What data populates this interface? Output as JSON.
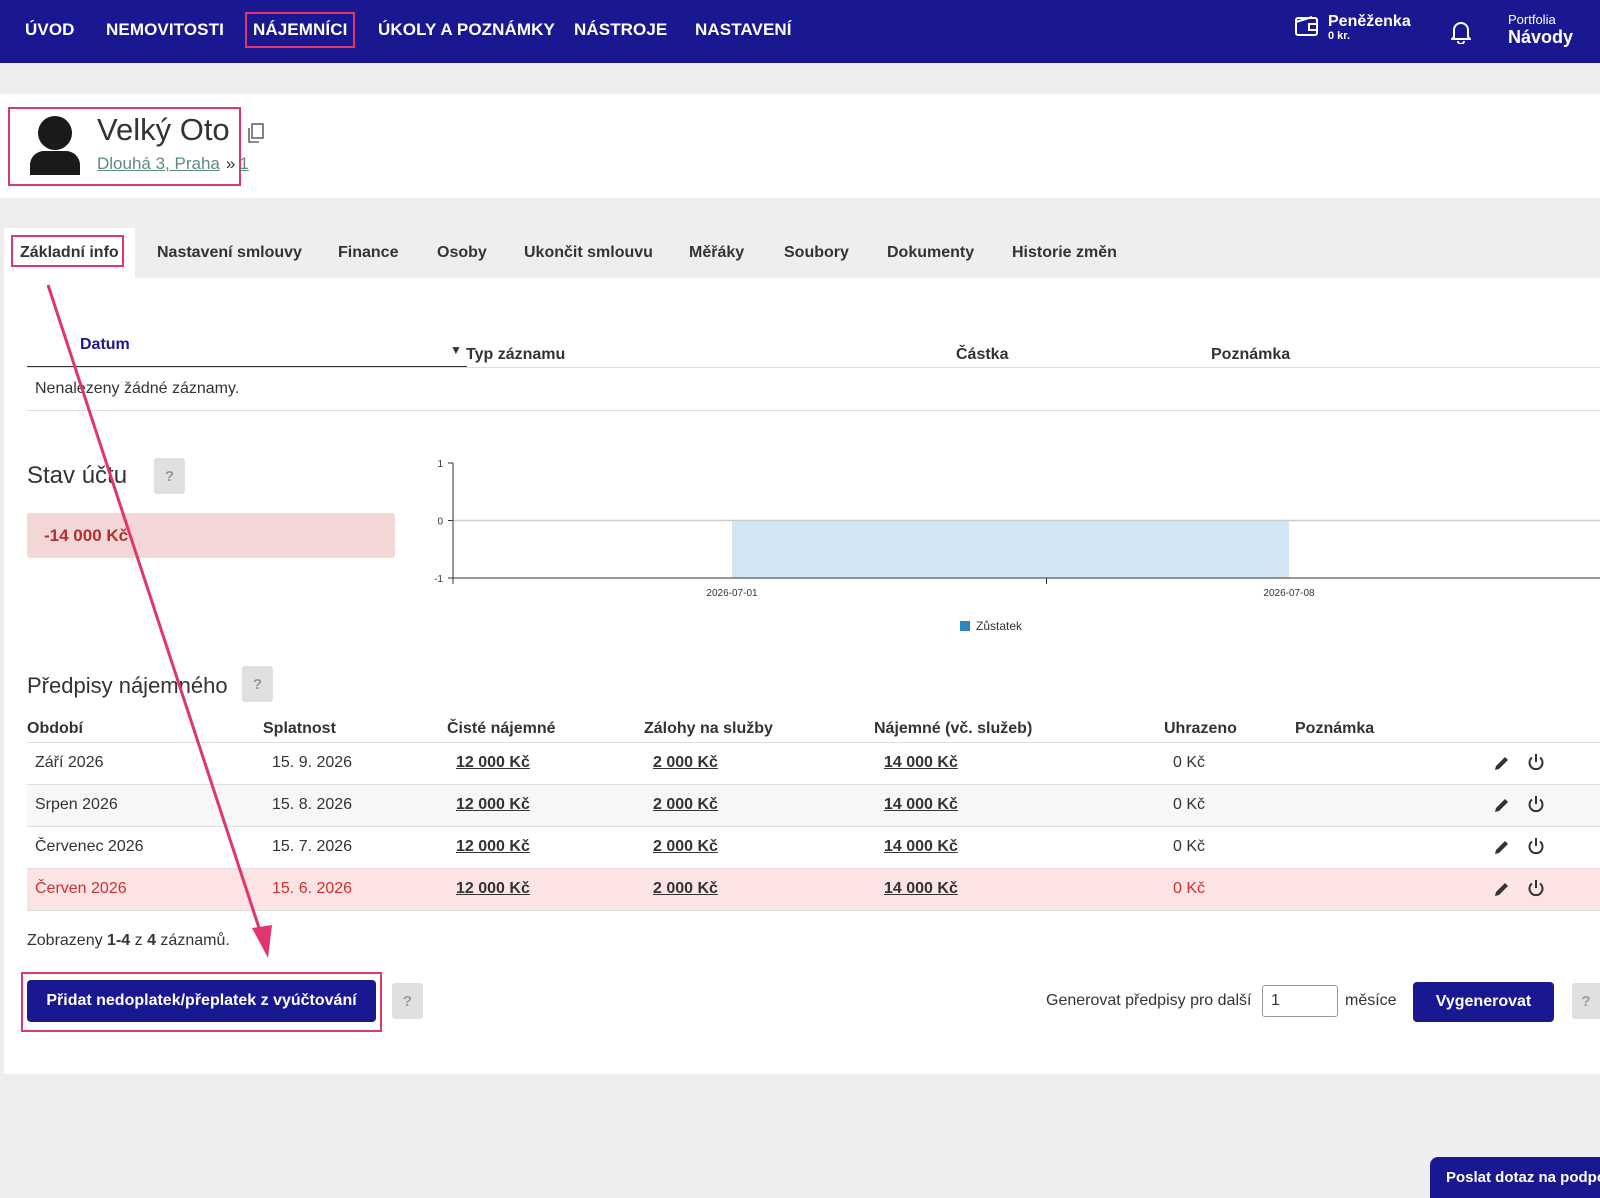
{
  "nav": {
    "items": [
      {
        "label": "ÚVOD"
      },
      {
        "label": "NEMOVITOSTI"
      },
      {
        "label": "NÁJEMNÍCI"
      },
      {
        "label": "ÚKOLY A POZNÁMKY"
      },
      {
        "label": "NÁSTROJE"
      },
      {
        "label": "NASTAVENÍ"
      }
    ],
    "active_index": 2,
    "wallet_title": "Peněženka",
    "wallet_amount": "0 kr.",
    "portfolio_label": "Portfolia",
    "portfolio_value": "Návody"
  },
  "tenant": {
    "name": "Velký Oto",
    "address_link": "Dlouhá 3, Praha",
    "separator": "»",
    "unit_link": "1"
  },
  "tabs": [
    {
      "label": "Základní info"
    },
    {
      "label": "Nastavení smlouvy"
    },
    {
      "label": "Finance"
    },
    {
      "label": "Osoby"
    },
    {
      "label": "Ukončit smlouvu"
    },
    {
      "label": "Měřáky"
    },
    {
      "label": "Soubory"
    },
    {
      "label": "Dokumenty"
    },
    {
      "label": "Historie změn"
    }
  ],
  "records": {
    "columns": [
      "Datum",
      "Typ záznamu",
      "Částka",
      "Poznámka"
    ],
    "sort_indicator": "▼",
    "empty_text": "Nenalezeny žádné záznamy."
  },
  "account": {
    "title": "Stav účtu",
    "help": "?",
    "balance": "-14 000 Kč"
  },
  "chart_data": {
    "type": "area",
    "x": [
      "2026-07-01",
      "2026-07-08"
    ],
    "series": [
      {
        "name": "Zůstatek",
        "values": [
          0,
          0
        ]
      }
    ],
    "ylim": [
      -1,
      1
    ],
    "yticks": [
      "1",
      "0",
      "-1"
    ],
    "xticks": [
      "2026-07-01",
      "2026-07-08"
    ],
    "legend_position": "bottom",
    "series_color": "#2e86c1",
    "fill_color": "#d4e6f4"
  },
  "rent": {
    "title": "Předpisy nájemného",
    "help": "?",
    "columns": [
      "Období",
      "Splatnost",
      "Čisté nájemné",
      "Zálohy na služby",
      "Nájemné (vč. služeb)",
      "Uhrazeno",
      "Poznámka"
    ],
    "rows": [
      {
        "period": "Září 2026",
        "due": "15. 9. 2026",
        "net": "12 000 Kč",
        "advances": "2 000 Kč",
        "total": "14 000 Kč",
        "paid": "0 Kč"
      },
      {
        "period": "Srpen 2026",
        "due": "15. 8. 2026",
        "net": "12 000 Kč",
        "advances": "2 000 Kč",
        "total": "14 000 Kč",
        "paid": "0 Kč"
      },
      {
        "period": "Červenec 2026",
        "due": "15. 7. 2026",
        "net": "12 000 Kč",
        "advances": "2 000 Kč",
        "total": "14 000 Kč",
        "paid": "0 Kč"
      },
      {
        "period": "Červen 2026",
        "due": "15. 6. 2026",
        "net": "12 000 Kč",
        "advances": "2 000 Kč",
        "total": "14 000 Kč",
        "paid": "0 Kč"
      }
    ],
    "showing_prefix": "Zobrazeny ",
    "showing_range": "1-4",
    "showing_mid": " z ",
    "showing_total": "4",
    "showing_suffix": " záznamů."
  },
  "actions": {
    "add_button": "Přidat nedoplatek/přeplatek z vyúčtování",
    "help": "?",
    "generate_label": "Generovat předpisy pro další",
    "generate_value": "1",
    "generate_unit": "měsíce",
    "generate_button": "Vygenerovat",
    "help2": "?"
  },
  "support": {
    "label": "Poslat dotaz na podpo"
  },
  "colors": {
    "nav_bg": "#1a1890",
    "highlight": "#e0356f",
    "overdue_bg": "#fde4e4",
    "overdue_text": "#d0302f"
  }
}
